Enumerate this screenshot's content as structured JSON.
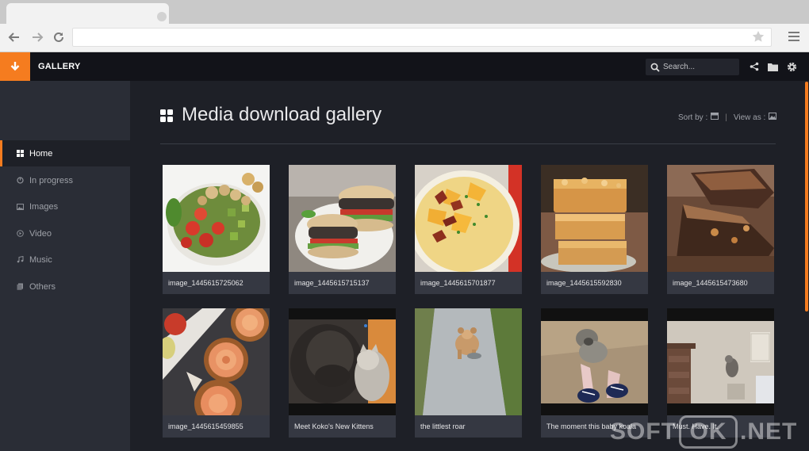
{
  "browser": {
    "url": "",
    "back_icon": "arrow-left-icon",
    "forward_icon": "arrow-right-icon",
    "reload_icon": "reload-icon",
    "star_icon": "star-icon",
    "menu_icon": "hamburger-menu-icon"
  },
  "app": {
    "brand": "GALLERY",
    "accent": "#f57c1f",
    "search_placeholder": "Search..."
  },
  "sidebar": {
    "items": [
      {
        "label": "Home",
        "icon": "grid-icon",
        "active": true
      },
      {
        "label": "In progress",
        "icon": "progress-icon",
        "active": false
      },
      {
        "label": "Images",
        "icon": "image-icon",
        "active": false
      },
      {
        "label": "Video",
        "icon": "play-icon",
        "active": false
      },
      {
        "label": "Music",
        "icon": "music-note-icon",
        "active": false
      },
      {
        "label": "Others",
        "icon": "files-icon",
        "active": false
      }
    ]
  },
  "main": {
    "title": "Media download gallery",
    "sort_label": "Sort by :",
    "view_label": "View as :",
    "separator": "|"
  },
  "gallery": [
    {
      "caption": "image_1445615725062"
    },
    {
      "caption": "image_1445615715137"
    },
    {
      "caption": "image_1445615701877"
    },
    {
      "caption": "image_1445615592830"
    },
    {
      "caption": "image_1445615473680"
    },
    {
      "caption": "image_1445615459855"
    },
    {
      "caption": "Meet Koko's New Kittens"
    },
    {
      "caption": "the littlest roar"
    },
    {
      "caption": "The moment this baby koala"
    },
    {
      "caption": "Must. Have. It."
    }
  ],
  "watermark": {
    "part1": "SOFT",
    "part2": "OK",
    "part3": ".NET"
  }
}
